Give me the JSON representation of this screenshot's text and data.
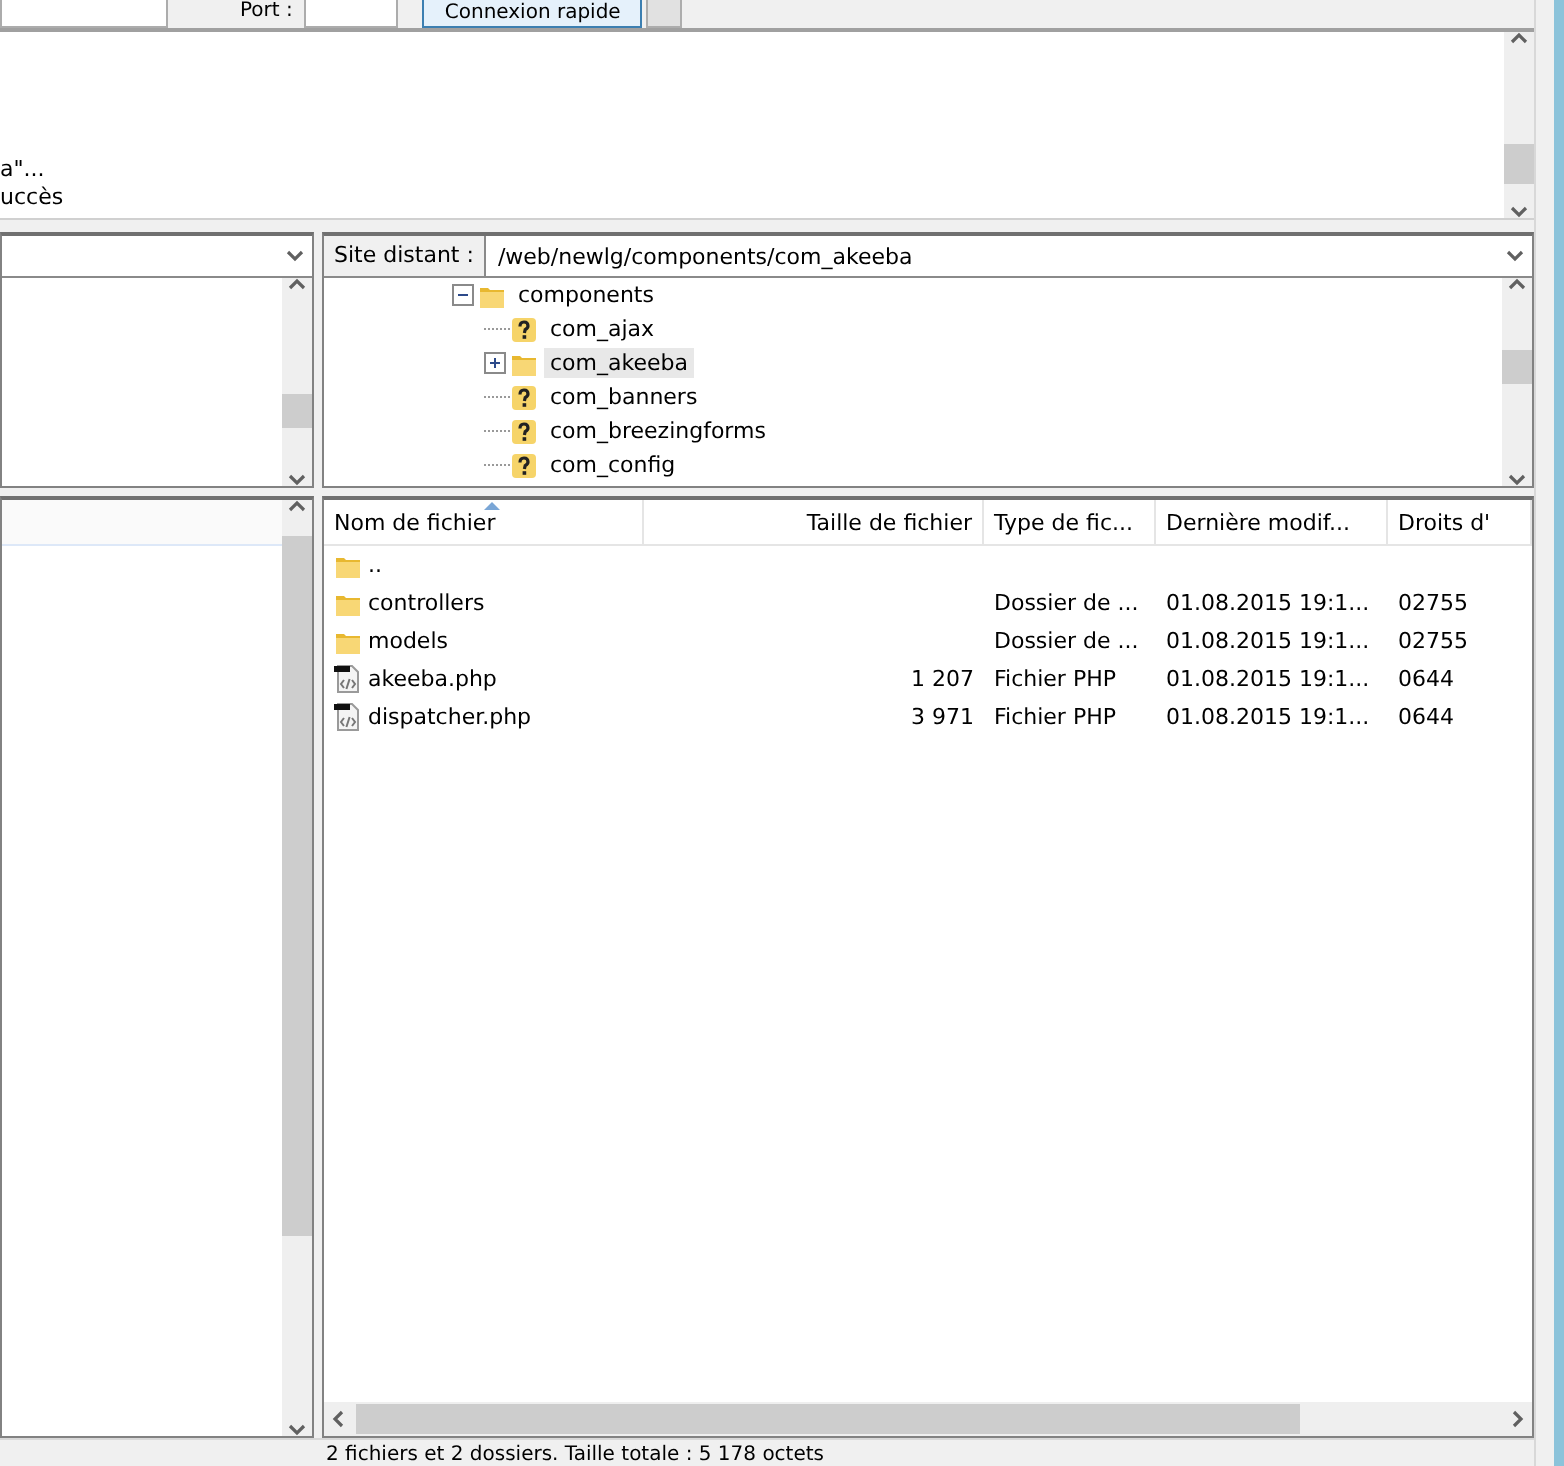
{
  "quickconnect": {
    "port_label": "Port :",
    "connect_button": "Connexion rapide"
  },
  "log": {
    "lines": [
      "a\"...",
      "uccès"
    ]
  },
  "remote_site": {
    "label": "Site distant :",
    "path": "/web/newlg/components/com_akeeba"
  },
  "remote_tree": [
    {
      "name": "components",
      "kind": "folder",
      "has_children": true,
      "expanded": true,
      "selected": false,
      "children": [
        {
          "name": "com_ajax",
          "kind": "unknown",
          "has_children": false,
          "expanded": false,
          "selected": false
        },
        {
          "name": "com_akeeba",
          "kind": "folder",
          "has_children": true,
          "expanded": false,
          "selected": true
        },
        {
          "name": "com_banners",
          "kind": "unknown",
          "has_children": false,
          "expanded": false,
          "selected": false
        },
        {
          "name": "com_breezingforms",
          "kind": "unknown",
          "has_children": false,
          "expanded": false,
          "selected": false
        },
        {
          "name": "com_config",
          "kind": "unknown",
          "has_children": false,
          "expanded": false,
          "selected": false
        }
      ]
    }
  ],
  "remote_files": {
    "columns": [
      {
        "label": "Nom de fichier",
        "sorted": true
      },
      {
        "label": "Taille de fichier",
        "sorted": false
      },
      {
        "label": "Type de fic...",
        "sorted": false
      },
      {
        "label": "Dernière modif...",
        "sorted": false
      },
      {
        "label": "Droits d'",
        "sorted": false
      }
    ],
    "rows": [
      {
        "kind": "folder",
        "cells": [
          "..",
          "",
          "",
          "",
          ""
        ]
      },
      {
        "kind": "folder",
        "cells": [
          "controllers",
          "",
          "Dossier de ...",
          "01.08.2015 19:1...",
          "02755"
        ]
      },
      {
        "kind": "folder",
        "cells": [
          "models",
          "",
          "Dossier de ...",
          "01.08.2015 19:1...",
          "02755"
        ]
      },
      {
        "kind": "file",
        "cells": [
          "akeeba.php",
          "1 207",
          "Fichier PHP",
          "01.08.2015 19:1...",
          "0644"
        ]
      },
      {
        "kind": "file",
        "cells": [
          "dispatcher.php",
          "3 971",
          "Fichier PHP",
          "01.08.2015 19:1...",
          "0644"
        ]
      }
    ]
  },
  "status_bar": {
    "remote": "2 fichiers et 2 dossiers. Taille totale : 5 178 octets"
  }
}
